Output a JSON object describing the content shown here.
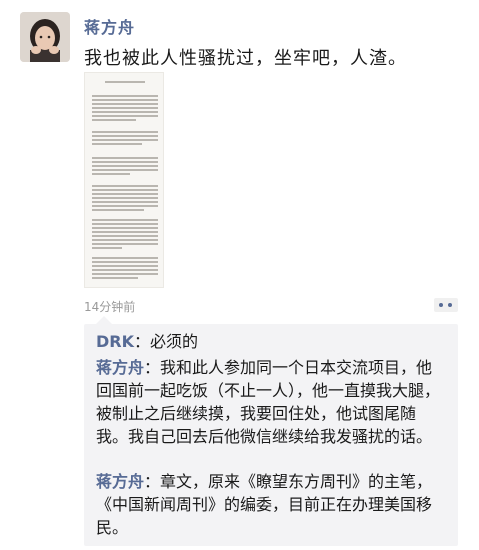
{
  "post": {
    "author": "蒋方舟",
    "text": "我也被此人性骚扰过，坐牢吧，人渣。",
    "time": "14分钟前"
  },
  "comments": [
    {
      "name": "DRK",
      "sep": "：",
      "text": "必须的"
    },
    {
      "name": "蒋方舟",
      "sep": "：",
      "text": "我和此人参加同一个日本交流项目，他回国前一起吃饭（不止一人），他一直摸我大腿，被制止之后继续摸，我要回住处，他试图尾随我。我自己回去后他微信继续给我发骚扰的话。"
    },
    {
      "name": "蒋方舟",
      "sep": "：",
      "text": "章文，原来《瞭望东方周刊》的主笔，《中国新闻周刊》的编委，目前正在办理美国移民。"
    }
  ],
  "icons": {
    "avatar": "avatar-photo",
    "more": "more-options-icon"
  },
  "colors": {
    "link": "#576b95",
    "comment_bg": "#f3f3f5",
    "time": "#9a9a9a"
  }
}
